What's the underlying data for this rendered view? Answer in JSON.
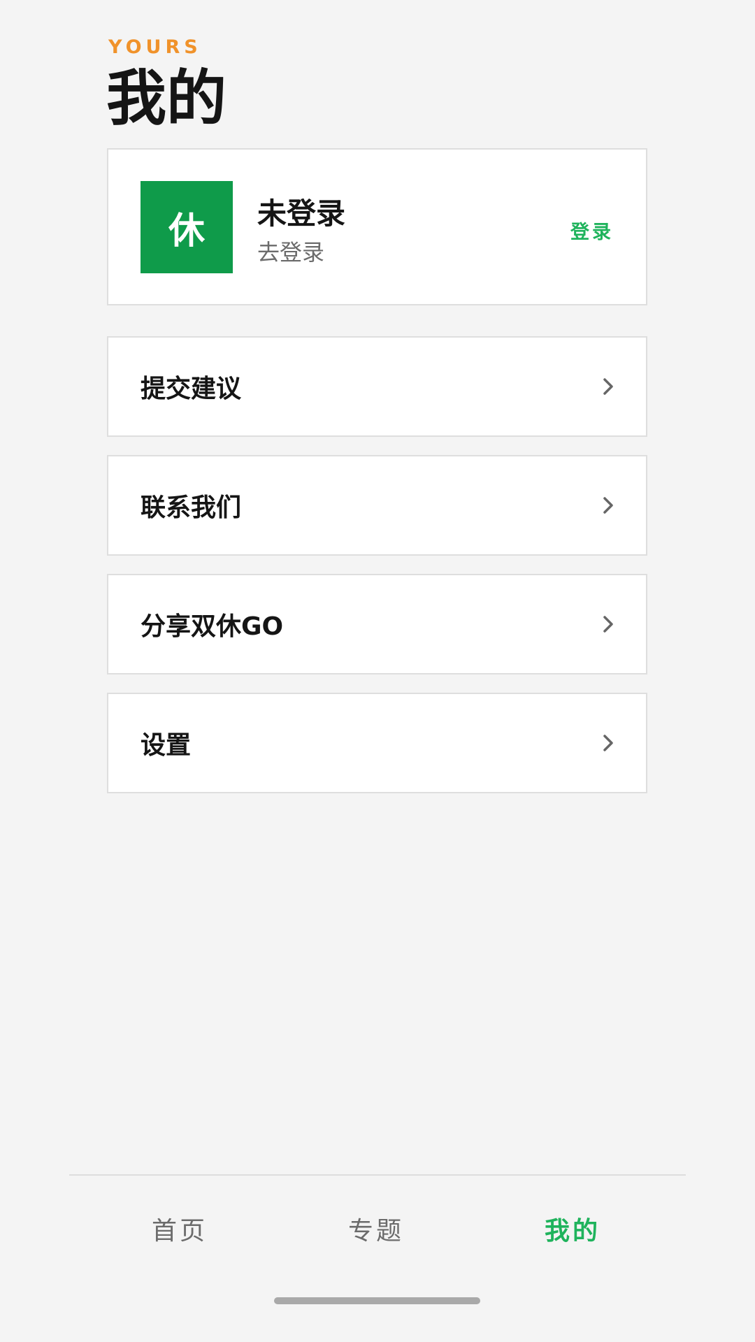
{
  "header": {
    "kicker": "YOURS",
    "title": "我的"
  },
  "profile": {
    "avatar_text": "休",
    "avatar_color": "#0f9b4a",
    "name": "未登录",
    "subtitle": "去登录",
    "login_label": "登录"
  },
  "menu": [
    {
      "label": "提交建议",
      "icon": "chevron-right-icon"
    },
    {
      "label": "联系我们",
      "icon": "chevron-right-icon"
    },
    {
      "label": "分享双休GO",
      "icon": "chevron-right-icon"
    },
    {
      "label": "设置",
      "icon": "chevron-right-icon"
    }
  ],
  "tabs": [
    {
      "label": "首页",
      "active": false
    },
    {
      "label": "专题",
      "active": false
    },
    {
      "label": "我的",
      "active": true
    }
  ],
  "colors": {
    "accent": "#1fb35c",
    "kicker": "#f0922a",
    "background": "#f4f4f4"
  }
}
